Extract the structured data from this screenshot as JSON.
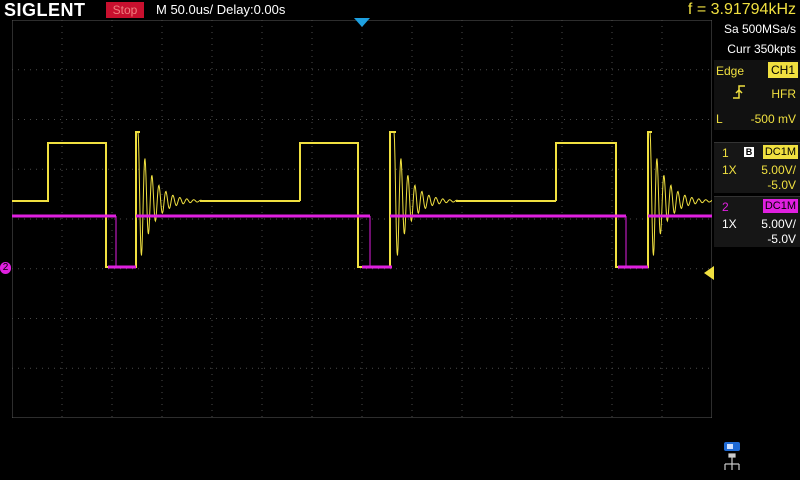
{
  "header": {
    "brand": "SIGLENT",
    "run_state": "Stop",
    "timebase": "M 50.0us/",
    "delay": "Delay:0.00s",
    "frequency": "f = 3.91794kHz"
  },
  "acquisition": {
    "sample_rate": "Sa 500MSa/s",
    "memory": "Curr 350kpts"
  },
  "trigger": {
    "type": "Edge",
    "source": "CH1",
    "coupling": "HFR",
    "level_label": "L",
    "level": "-500 mV"
  },
  "channels": [
    {
      "num": "1",
      "bw": "B",
      "coupling": "DC1M",
      "probe": "1X",
      "scale": "5.00V/",
      "offset": "-5.0V",
      "color": "#f0e040"
    },
    {
      "num": "2",
      "bw": "",
      "coupling": "DC1M",
      "probe": "1X",
      "scale": "5.00V/",
      "offset": "-5.0V",
      "color": "#e020e0"
    }
  ],
  "markers": {
    "ch2_marker": "2"
  },
  "colors": {
    "ch1": "#f0e040",
    "ch2": "#e020e0",
    "trigger_marker": "#1ea0e0",
    "grid": "#5a5a5a"
  }
}
